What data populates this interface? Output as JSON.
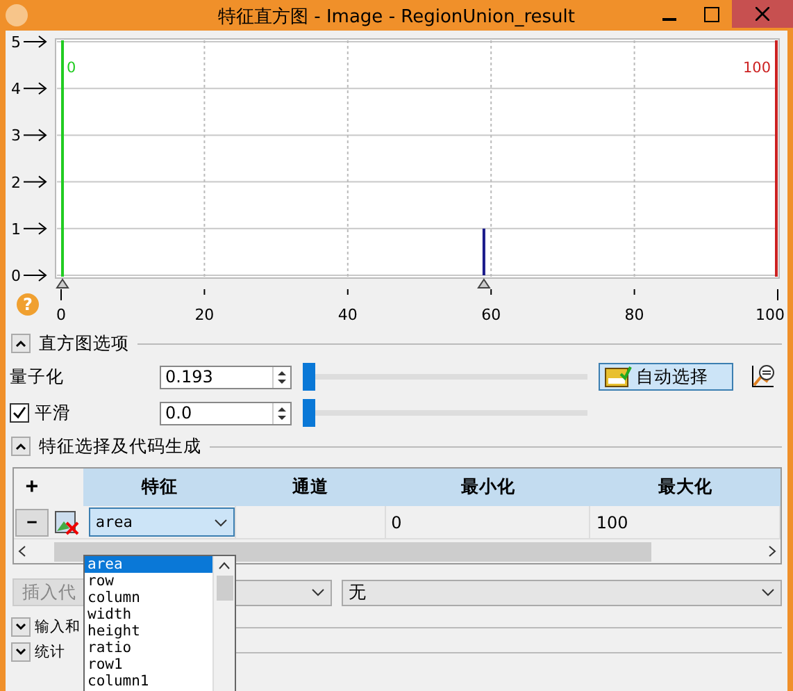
{
  "window": {
    "title": "特征直方图 - Image - RegionUnion_result"
  },
  "chart_data": {
    "type": "bar",
    "x": [
      59
    ],
    "values": [
      1
    ],
    "xlim": [
      0,
      100
    ],
    "ylim": [
      0,
      5
    ],
    "xticks": [
      0,
      20,
      40,
      60,
      80,
      100
    ],
    "yticks": [
      0,
      1,
      2,
      3,
      4,
      5
    ],
    "grid": true
  },
  "thresholds": [
    {
      "label": "0",
      "color": "#22cc22"
    },
    {
      "label": "100",
      "color": "#cc2222"
    }
  ],
  "help": "?",
  "histogram_options": {
    "title": "直方图选项",
    "expanded": true,
    "rows": [
      {
        "kind": "plain",
        "label": "量子化",
        "value": "0.193",
        "level": 0
      },
      {
        "kind": "checkbox",
        "label": "平滑",
        "checked": true,
        "value": "0.0",
        "level": 0
      }
    ],
    "auto_button": "自动选择"
  },
  "feature_section": {
    "title": "特征选择及代码生成",
    "expanded": true,
    "table": {
      "add": "+",
      "remove": "−",
      "columns": [
        "特征",
        "通道",
        "最小化",
        "最大化"
      ],
      "rows": [
        {
          "feature": "area",
          "min": "0",
          "max": "100"
        }
      ]
    },
    "dropdown": [
      {
        "label": "area",
        "selected": true
      },
      {
        "label": "row",
        "selected": false
      },
      {
        "label": "column",
        "selected": false
      },
      {
        "label": "width",
        "selected": false
      },
      {
        "label": "height",
        "selected": false
      },
      {
        "label": "ratio",
        "selected": false
      },
      {
        "label": "row1",
        "selected": false
      },
      {
        "label": "column1",
        "selected": false
      }
    ],
    "insert_button": {
      "label": "插入代",
      "disabled": true
    },
    "combo_2": "无"
  },
  "collapsed_sections": [
    {
      "title": "输入和",
      "expanded": false
    },
    {
      "title": "统计",
      "expanded": false
    }
  ]
}
